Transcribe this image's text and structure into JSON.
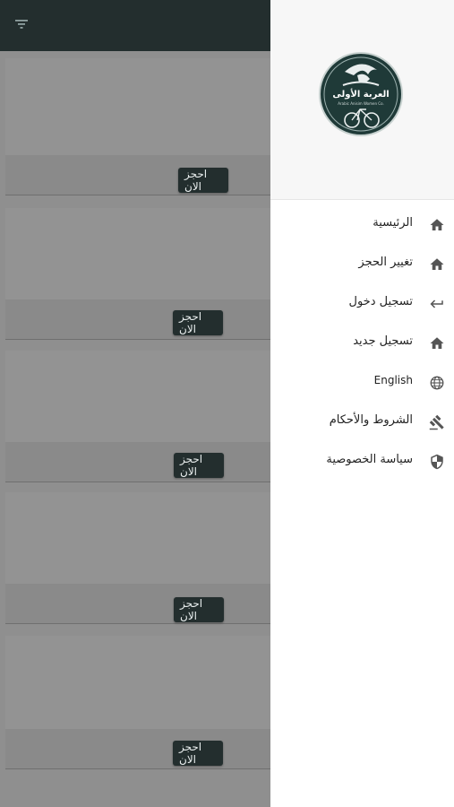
{
  "book_button_label": "احجز الان",
  "drawer": {
    "logo": {
      "title": "العربة الأولى",
      "subtitle": "Arabic Anisim Women Co."
    },
    "items": [
      {
        "label": "الرئيسية",
        "icon": "home-icon"
      },
      {
        "label": "تغيير الحجز",
        "icon": "home-icon"
      },
      {
        "label": "تسجيل دخول",
        "icon": "login-arrow-icon"
      },
      {
        "label": "تسجيل جديد",
        "icon": "home-icon"
      },
      {
        "label": "English",
        "icon": "globe-icon"
      },
      {
        "label": "الشروط والأحكام",
        "icon": "gavel-icon"
      },
      {
        "label": "سياسة الخصوصية",
        "icon": "shield-icon"
      }
    ]
  },
  "colors": {
    "appbar": "#232e2e",
    "button": "#232e2e",
    "scrim": "#8f8f8f",
    "drawer_bg": "#ffffff"
  }
}
